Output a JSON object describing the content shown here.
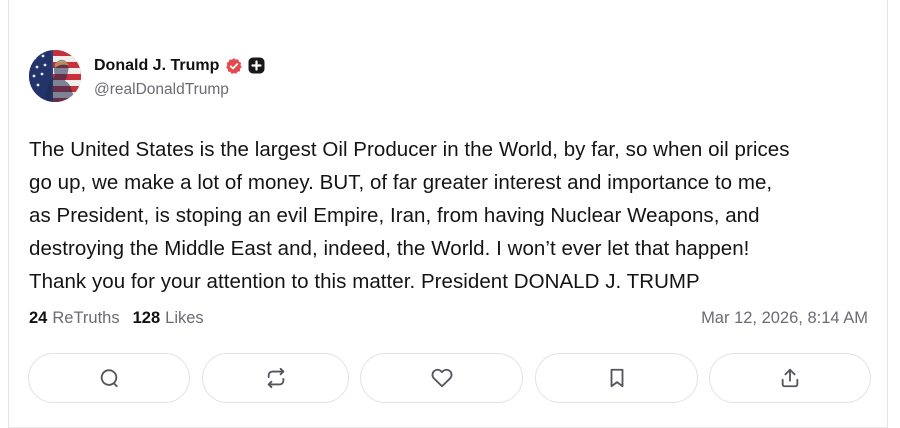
{
  "author": {
    "display_name": "Donald J. Trump",
    "handle": "@realDonaldTrump",
    "avatar_icon": "flag-portrait-avatar",
    "verified_icon": "verified-badge-icon",
    "verified_color": "#e5484d",
    "plus_icon": "plus-badge-icon"
  },
  "post": {
    "lines": [
      "The United States is the largest Oil Producer in the World, by far, so when oil prices",
      "go up, we make a lot of money. BUT, of far greater interest and importance to me,",
      "as President, is stoping an evil Empire, Iran, from having Nuclear Weapons, and",
      "destroying the Middle East and, indeed, the World. I won’t ever let that happen!",
      "Thank you for your attention to this matter. President DONALD J. TRUMP"
    ]
  },
  "stats": {
    "retruths_count": "24",
    "retruths_label": "ReTruths",
    "likes_count": "128",
    "likes_label": "Likes"
  },
  "timestamp": "Mar 12, 2026, 8:14 AM",
  "actions": [
    {
      "icon": "reply-icon"
    },
    {
      "icon": "retruth-icon"
    },
    {
      "icon": "like-heart-icon"
    },
    {
      "icon": "bookmark-icon"
    },
    {
      "icon": "share-icon"
    }
  ],
  "colors": {
    "text": "#111111",
    "muted": "#6b6b73",
    "border": "#e2e2e6",
    "icon": "#55555e"
  }
}
